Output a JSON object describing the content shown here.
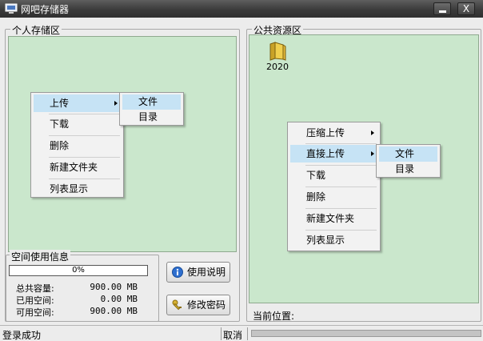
{
  "window": {
    "title": "网吧存储器",
    "close": "X"
  },
  "personal": {
    "title": "个人存储区",
    "menu": [
      "上传",
      "下载",
      "删除",
      "新建文件夹",
      "列表显示"
    ],
    "submenu": [
      "文件",
      "目录"
    ]
  },
  "public": {
    "title": "公共资源区",
    "folder": "2020",
    "menu": [
      "压缩上传",
      "直接上传",
      "下载",
      "删除",
      "新建文件夹",
      "列表显示"
    ],
    "submenu": [
      "文件",
      "目录"
    ],
    "current_location": "当前位置:"
  },
  "space": {
    "title": "空间使用信息",
    "progress_percent": 0,
    "progress_text": "0%",
    "rows": [
      {
        "label": "总共容量:",
        "value": "900.00 MB"
      },
      {
        "label": "已用空间:",
        "value": "0.00 MB"
      },
      {
        "label": "可用空间:",
        "value": "900.00 MB"
      }
    ]
  },
  "buttons": {
    "help": "使用说明",
    "change_password": "修改密码"
  },
  "status": {
    "text": "登录成功",
    "cancel": "取消"
  },
  "colors": {
    "panel": "#cae7cc",
    "highlight": "#c6e3f5",
    "titlebar": "#3b3b3b"
  }
}
